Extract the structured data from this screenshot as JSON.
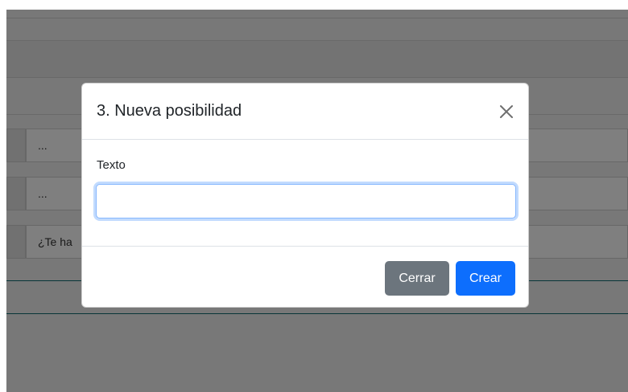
{
  "background": {
    "row_texts": [
      "...",
      "...",
      "¿Te ha"
    ]
  },
  "modal": {
    "title": "3. Nueva posibilidad",
    "close_icon": "close-icon",
    "field_label": "Texto",
    "input_value": "",
    "close_button_label": "Cerrar",
    "create_button_label": "Crear"
  },
  "colors": {
    "primary": "#0d6efd",
    "secondary": "#6c757d",
    "backdrop": "rgba(0,0,0,0.5)"
  }
}
